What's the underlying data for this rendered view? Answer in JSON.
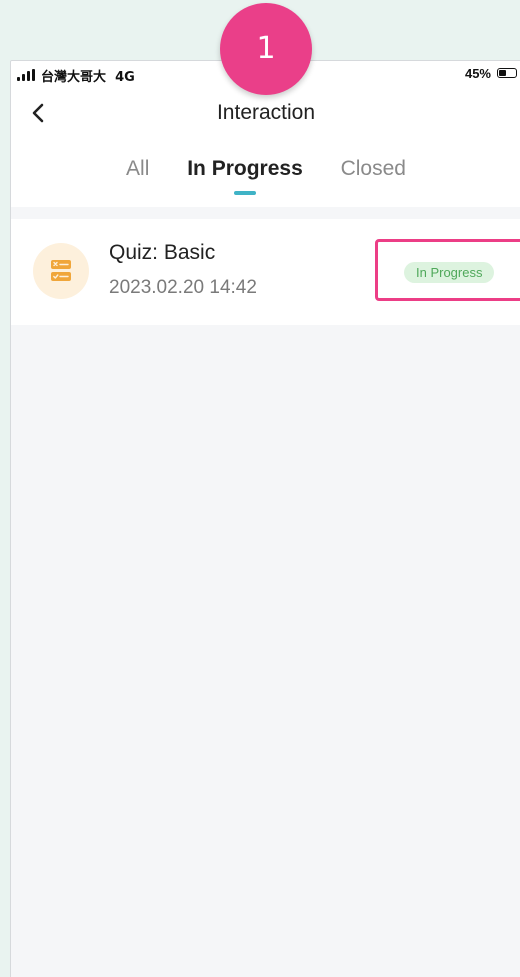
{
  "status_bar": {
    "carrier": "台灣大哥大",
    "network": "4G",
    "battery_percent": "45%",
    "battery_level": 0.45
  },
  "header": {
    "title": "Interaction",
    "back_icon": "chevron-left-icon"
  },
  "tabs": [
    {
      "label": "All",
      "active": false
    },
    {
      "label": "In Progress",
      "active": true
    },
    {
      "label": "Closed",
      "active": false
    }
  ],
  "items": [
    {
      "title": "Quiz: Basic",
      "date": "2023.02.20 14:42",
      "status": "In Progress",
      "icon": "quiz-icon"
    }
  ],
  "annotation": {
    "step": "1"
  },
  "colors": {
    "accent": "#3fb3c6",
    "highlight": "#ec3e86",
    "badge_bg": "#ddf3df",
    "badge_text": "#4fa85a",
    "icon_bg": "#fdf0dc",
    "icon_fg": "#f0a63a"
  }
}
